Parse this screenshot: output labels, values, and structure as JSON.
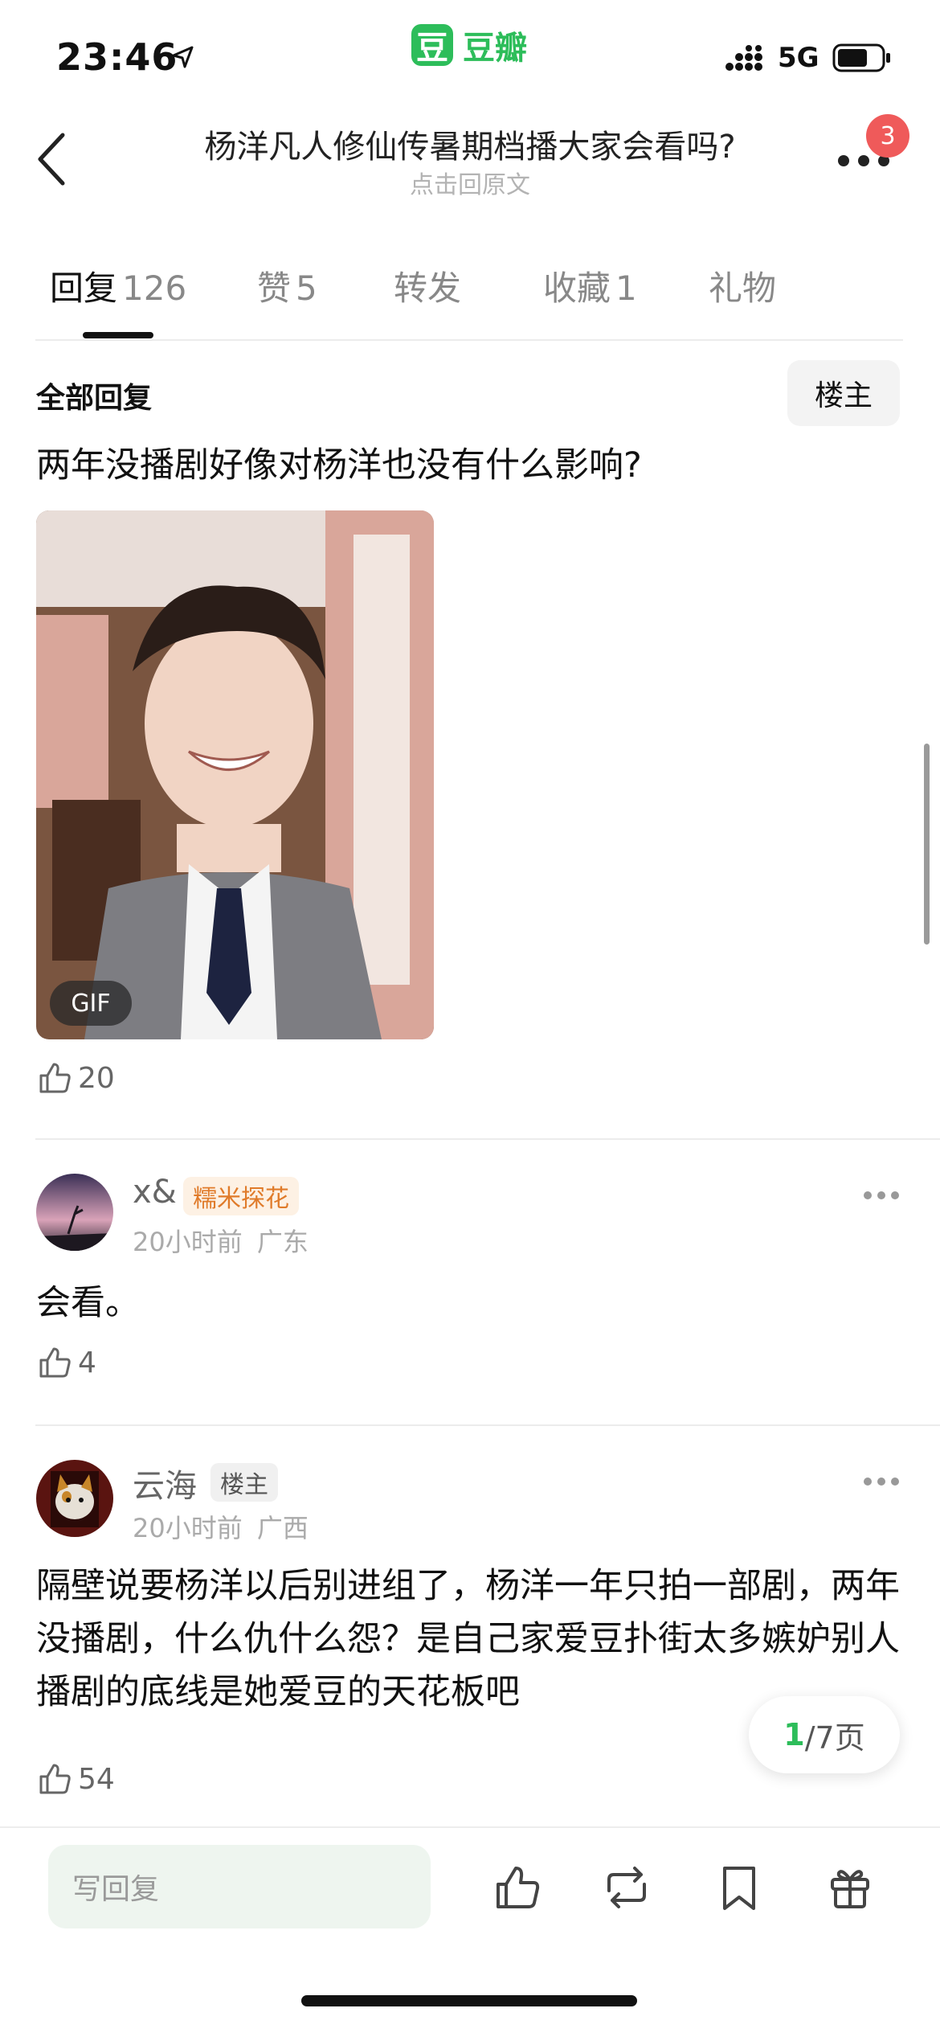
{
  "status_bar": {
    "time": "23:46",
    "network": "5G"
  },
  "app": {
    "name": "豆瓣",
    "logo_char": "豆",
    "brand_color": "#2dbd5a"
  },
  "nav": {
    "title": "杨洋凡人修仙传暑期档播大家会看吗?",
    "subtitle": "点击回原文",
    "badge_count": "3"
  },
  "tabs": [
    {
      "label": "回复",
      "count": "126"
    },
    {
      "label": "赞",
      "count": "5"
    },
    {
      "label": "转发",
      "count": ""
    },
    {
      "label": "收藏",
      "count": "1"
    },
    {
      "label": "礼物",
      "count": ""
    }
  ],
  "filter": {
    "all_label": "全部回复",
    "op_label": "楼主"
  },
  "post": {
    "text": "两年没播剧好像对杨洋也没有什么影响?",
    "image_badge": "GIF",
    "likes": "20"
  },
  "comments": [
    {
      "username": "x&",
      "tag": "糯米探花",
      "time": "20小时前",
      "location": "广东",
      "text": "会看。",
      "likes": "4"
    },
    {
      "username": "云海",
      "tag": "楼主",
      "time": "20小时前",
      "location": "广西",
      "text": "隔壁说要杨洋以后别进组了，杨洋一年只拍一部剧，两年没播剧，什么仇什么怨？是自己家爱豆扑街太多嫉妒别人播剧的底线是她爱豆的天花板吧",
      "likes": "54"
    }
  ],
  "pager": {
    "current": "1",
    "rest": "/7页"
  },
  "bottom": {
    "reply_placeholder": "写回复"
  }
}
